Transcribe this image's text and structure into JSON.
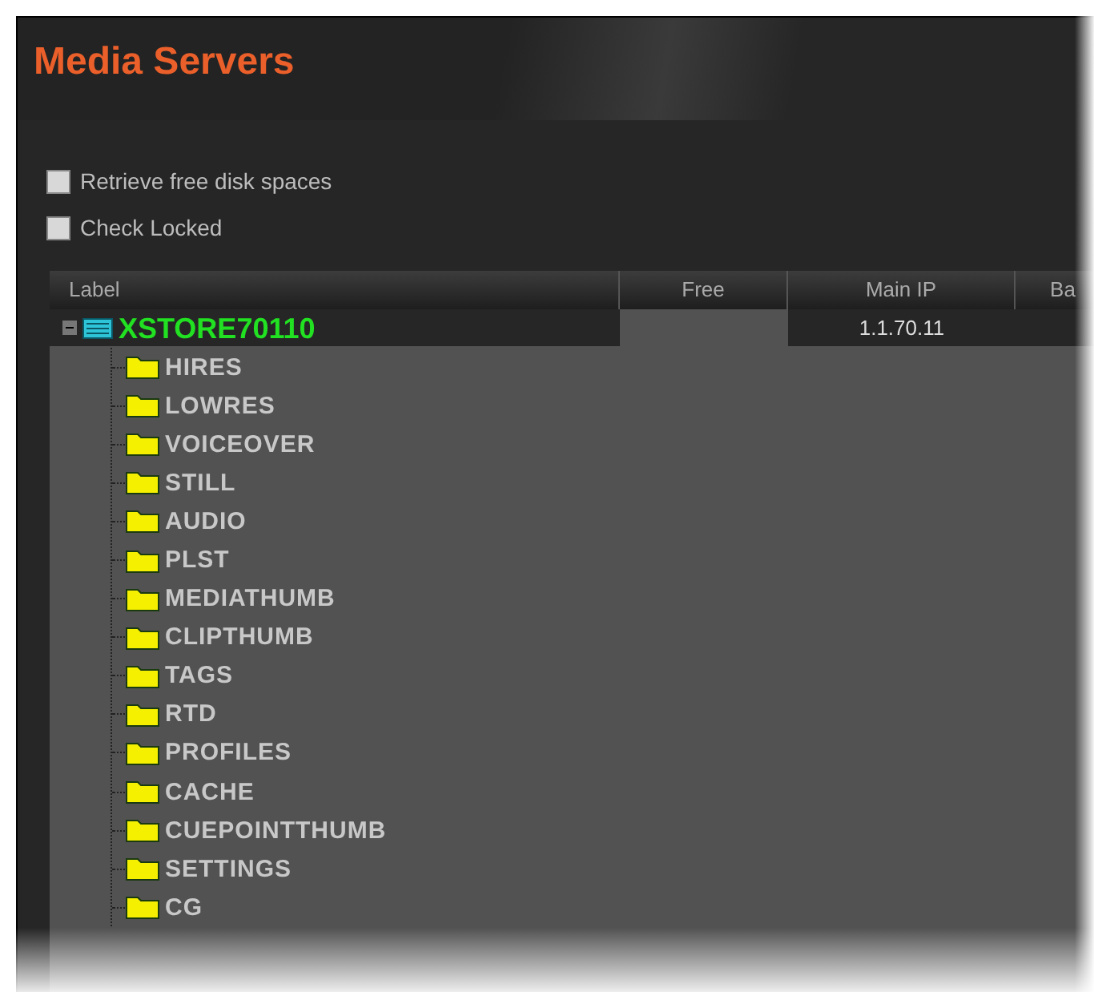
{
  "title": "Media Servers",
  "options": [
    {
      "label": "Retrieve free disk spaces",
      "checked": false
    },
    {
      "label": "Check Locked",
      "checked": false
    }
  ],
  "table": {
    "columns": [
      "Label",
      "Free",
      "Main IP",
      "Ba"
    ],
    "rows": [
      {
        "label": "XSTORE70110",
        "main_ip": "1.1.70.11",
        "expanded": true,
        "children": [
          {
            "label": "HIRES"
          },
          {
            "label": "LOWRES"
          },
          {
            "label": "VOICEOVER"
          },
          {
            "label": "STILL"
          },
          {
            "label": "AUDIO"
          },
          {
            "label": "PLST"
          },
          {
            "label": "MEDIATHUMB"
          },
          {
            "label": "CLIPTHUMB"
          },
          {
            "label": "TAGS"
          },
          {
            "label": "RTD"
          },
          {
            "label": "PROFILES"
          },
          {
            "label": "CACHE"
          },
          {
            "label": "CUEPOINTTHUMB"
          },
          {
            "label": "SETTINGS"
          },
          {
            "label": "CG"
          }
        ]
      }
    ]
  }
}
